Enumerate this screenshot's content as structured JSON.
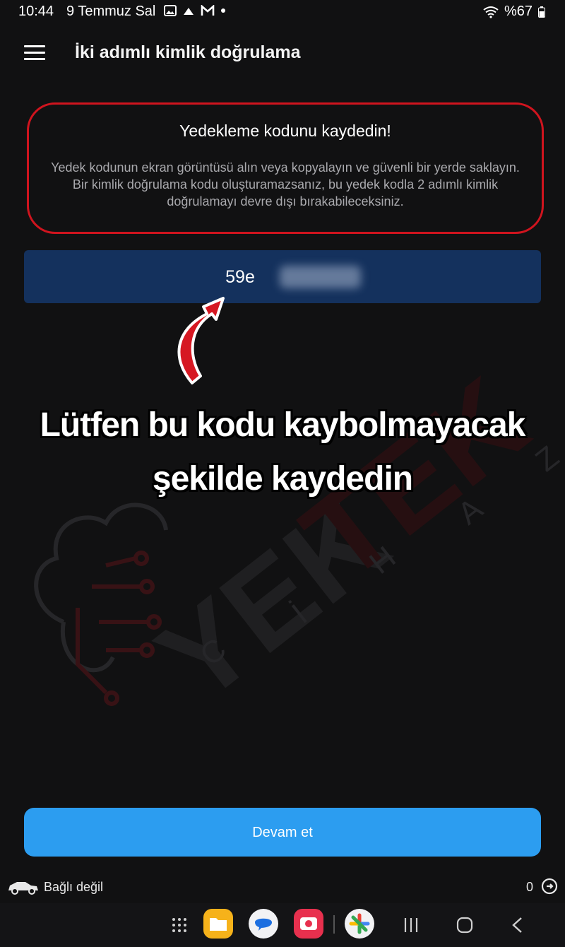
{
  "status_bar": {
    "time": "10:44",
    "date": "9 Temmuz Sal",
    "battery": "%67",
    "icons": [
      "image-icon",
      "cloud-icon",
      "gmail-icon",
      "dot-icon",
      "wifi-icon",
      "battery-icon"
    ]
  },
  "app_bar": {
    "menu_icon": "hamburger-menu-icon",
    "title": "İki adımlı kimlik doğrulama"
  },
  "info": {
    "title": "Yedekleme kodunu kaydedin!",
    "text": "Yedek kodunun ekran görüntüsü alın veya kopyalayın ve güvenli bir yerde saklayın. Bir kimlik doğrulama kodu oluşturamazsanız, bu yedek kodla 2 adımlı kimlik doğrulamayı devre dışı bırakabileceksiniz."
  },
  "backup_code": {
    "visible_prefix": "59e"
  },
  "overlay": {
    "line1": "Lütfen bu kodu kaybolmayacak",
    "line2": "şekilde kaydedin"
  },
  "watermark": {
    "text_left": "YEK",
    "text_right": "TEK",
    "subtitle_letters": [
      "C",
      "İ",
      "H",
      "A",
      "Z"
    ]
  },
  "actions": {
    "continue_label": "Devam et"
  },
  "footer": {
    "connection_label": "Bağlı değil",
    "count": "0"
  },
  "colors": {
    "background": "#111112",
    "highlight_border": "#d0141e",
    "code_box": "#14315d",
    "primary_button": "#2c9df0"
  },
  "navbar": {
    "icons": [
      "apps-grid-icon",
      "files-app-icon",
      "messages-app-icon",
      "camera-app-icon",
      "photos-app-icon",
      "recents-icon",
      "home-icon",
      "back-icon"
    ]
  }
}
